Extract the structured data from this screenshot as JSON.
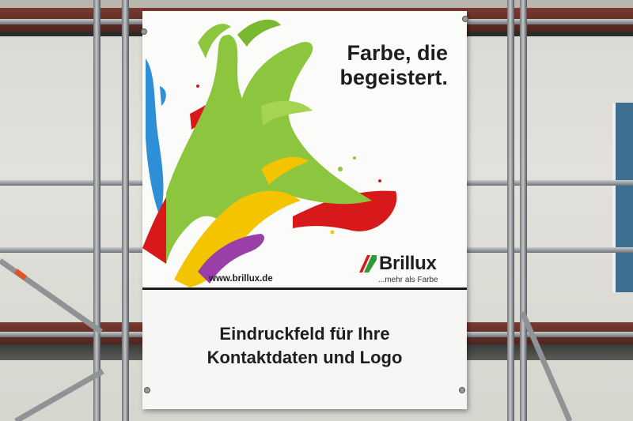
{
  "banner": {
    "headline_line1": "Farbe, die",
    "headline_line2": "begeistert.",
    "url": "www.brillux.de",
    "brand": "Brillux",
    "tagline": "...mehr als Farbe",
    "imprint_line1": "Eindruckfeld für Ihre",
    "imprint_line2": "Kontaktdaten und Logo"
  },
  "colors": {
    "paint_green": "#8cc63f",
    "paint_red": "#d7191c",
    "paint_yellow": "#f5c400",
    "paint_purple": "#9b3fa8",
    "paint_blue": "#2f8fd6",
    "scaffold_beam": "#6b302a",
    "banner_bg": "#f6f6f4"
  },
  "icons": [
    "brillux-logo-icon",
    "paint-splash-illustration"
  ]
}
